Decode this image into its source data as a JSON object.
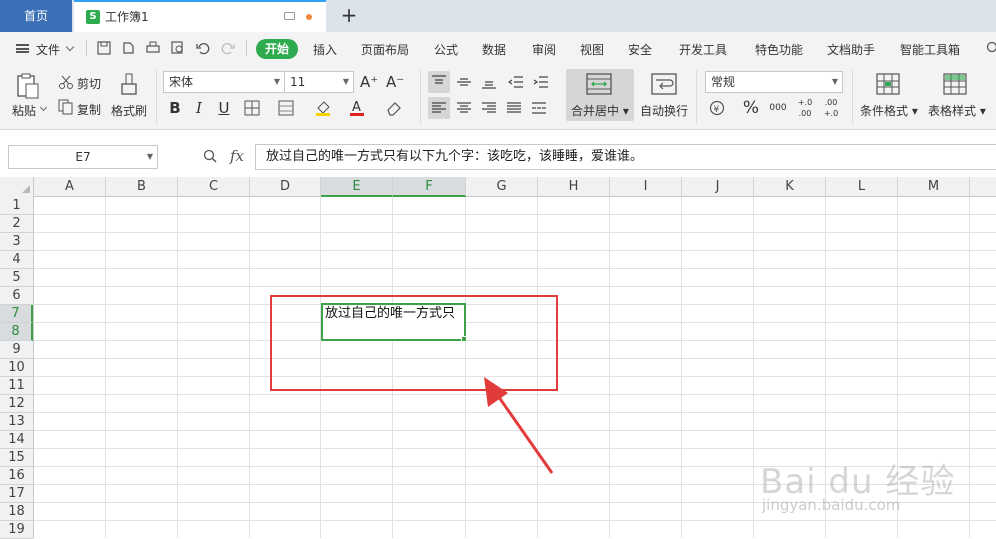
{
  "tabs": {
    "home": "首页",
    "workbook": "工作簿1",
    "workbook_icon": "S",
    "add": "+"
  },
  "menu": {
    "file": "文件",
    "items": [
      "开始",
      "插入",
      "页面布局",
      "公式",
      "数据",
      "审阅",
      "视图",
      "安全",
      "开发工具",
      "特色功能",
      "文档助手",
      "智能工具箱"
    ]
  },
  "ribbon": {
    "paste": "粘贴",
    "cut": "剪切",
    "copy": "复制",
    "format_painter": "格式刷",
    "font_name": "宋体",
    "font_size": "11",
    "merge_center": "合并居中",
    "auto_wrap": "自动换行",
    "number_format": "常规",
    "conditional_format": "条件格式",
    "table_style": "表格样式",
    "grow_font": "A⁺",
    "shrink_font": "A⁻",
    "bold": "B",
    "italic": "I",
    "underline": "U",
    "percent": "%",
    "thousands": "000",
    "inc_decimal": "+.0 .00",
    "dec_decimal": ".00 +.0"
  },
  "formula_bar": {
    "cell_ref": "E7",
    "fx": "fx",
    "content": "放过自己的唯一方式只有以下九个字：该吃吃，该睡睡，爱谁谁。"
  },
  "sheet": {
    "columns": [
      "A",
      "B",
      "C",
      "D",
      "E",
      "F",
      "G",
      "H",
      "I",
      "J",
      "K",
      "L",
      "M"
    ],
    "rows": [
      "1",
      "2",
      "3",
      "4",
      "5",
      "6",
      "7",
      "8",
      "9",
      "10",
      "11",
      "12",
      "13",
      "14",
      "15",
      "16",
      "17",
      "18",
      "19"
    ],
    "selected_columns": [
      "E",
      "F"
    ],
    "selected_rows": [
      "7",
      "8"
    ],
    "cell_e7_visible_text": "放过自己的唯一方式只"
  },
  "watermark": {
    "logo": "Bai du 经验",
    "url": "jingyan.baidu.com"
  },
  "colors": {
    "accent_green": "#2eaa4f",
    "home_tab": "#3b6fb6",
    "annotation_red": "#e23b3b"
  }
}
